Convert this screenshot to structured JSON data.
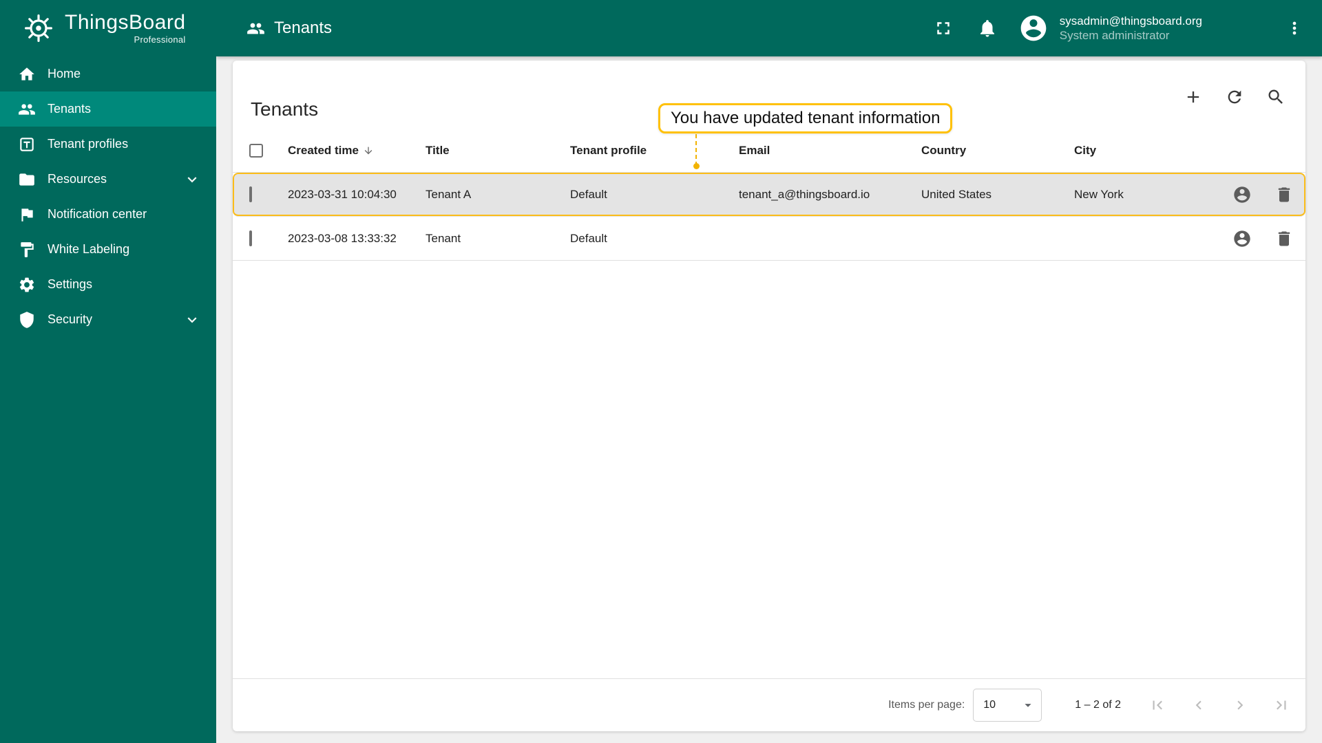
{
  "colors": {
    "primary": "#00695c",
    "primary_light": "#00897b",
    "accent": "#ffc107",
    "row_highlight_bg": "#e4e4e4"
  },
  "brand": {
    "name": "ThingsBoard",
    "subtitle": "Professional"
  },
  "header": {
    "title": "Tenants",
    "user": {
      "email": "sysadmin@thingsboard.org",
      "role": "System administrator"
    }
  },
  "sidebar": {
    "items": [
      {
        "label": "Home"
      },
      {
        "label": "Tenants"
      },
      {
        "label": "Tenant profiles"
      },
      {
        "label": "Resources"
      },
      {
        "label": "Notification center"
      },
      {
        "label": "White Labeling"
      },
      {
        "label": "Settings"
      },
      {
        "label": "Security"
      }
    ]
  },
  "page": {
    "card_title": "Tenants",
    "tooltip": "You have updated tenant information"
  },
  "table": {
    "headers": {
      "created": "Created time",
      "title": "Title",
      "profile": "Tenant profile",
      "email": "Email",
      "country": "Country",
      "city": "City"
    },
    "rows": [
      {
        "created": "2023-03-31 10:04:30",
        "title": "Tenant A",
        "profile": "Default",
        "email": "tenant_a@thingsboard.io",
        "country": "United States",
        "city": "New York"
      },
      {
        "created": "2023-03-08 13:33:32",
        "title": "Tenant",
        "profile": "Default",
        "email": "",
        "country": "",
        "city": ""
      }
    ]
  },
  "pagination": {
    "items_per_page_label": "Items per page:",
    "per_page": "10",
    "range": "1 – 2 of 2"
  }
}
